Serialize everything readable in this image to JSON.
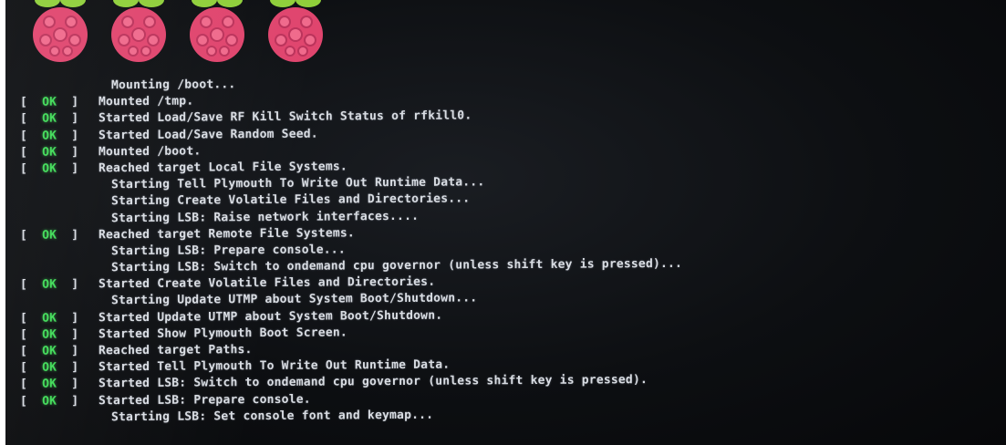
{
  "screen": {
    "status_ok": "OK",
    "colors": {
      "background": "#0d0f12",
      "text": "#d9dde3",
      "ok": "#3fdc57",
      "raspberry": "#e0456e",
      "leaf": "#7fbf3a"
    },
    "logo_count": 4,
    "lines": [
      {
        "kind": "progress",
        "text": "Mounting /boot..."
      },
      {
        "kind": "ok",
        "text": "Mounted /tmp."
      },
      {
        "kind": "ok",
        "text": "Started Load/Save RF Kill Switch Status of rfkill0."
      },
      {
        "kind": "ok",
        "text": "Started Load/Save Random Seed."
      },
      {
        "kind": "ok",
        "text": "Mounted /boot."
      },
      {
        "kind": "ok",
        "text": "Reached target Local File Systems."
      },
      {
        "kind": "progress",
        "text": "Starting Tell Plymouth To Write Out Runtime Data..."
      },
      {
        "kind": "progress",
        "text": "Starting Create Volatile Files and Directories..."
      },
      {
        "kind": "progress",
        "text": "Starting LSB: Raise network interfaces...."
      },
      {
        "kind": "ok",
        "text": "Reached target Remote File Systems."
      },
      {
        "kind": "progress",
        "text": "Starting LSB: Prepare console..."
      },
      {
        "kind": "progress",
        "text": "Starting LSB: Switch to ondemand cpu governor (unless shift key is pressed)..."
      },
      {
        "kind": "ok",
        "text": "Started Create Volatile Files and Directories."
      },
      {
        "kind": "progress",
        "text": "Starting Update UTMP about System Boot/Shutdown..."
      },
      {
        "kind": "ok",
        "text": "Started Update UTMP about System Boot/Shutdown."
      },
      {
        "kind": "ok",
        "text": "Started Show Plymouth Boot Screen."
      },
      {
        "kind": "ok",
        "text": "Reached target Paths."
      },
      {
        "kind": "ok",
        "text": "Started Tell Plymouth To Write Out Runtime Data."
      },
      {
        "kind": "ok",
        "text": "Started LSB: Switch to ondemand cpu governor (unless shift key is pressed)."
      },
      {
        "kind": "ok",
        "text": "Started LSB: Prepare console."
      },
      {
        "kind": "progress",
        "text": "Starting LSB: Set console font and keymap..."
      }
    ]
  }
}
